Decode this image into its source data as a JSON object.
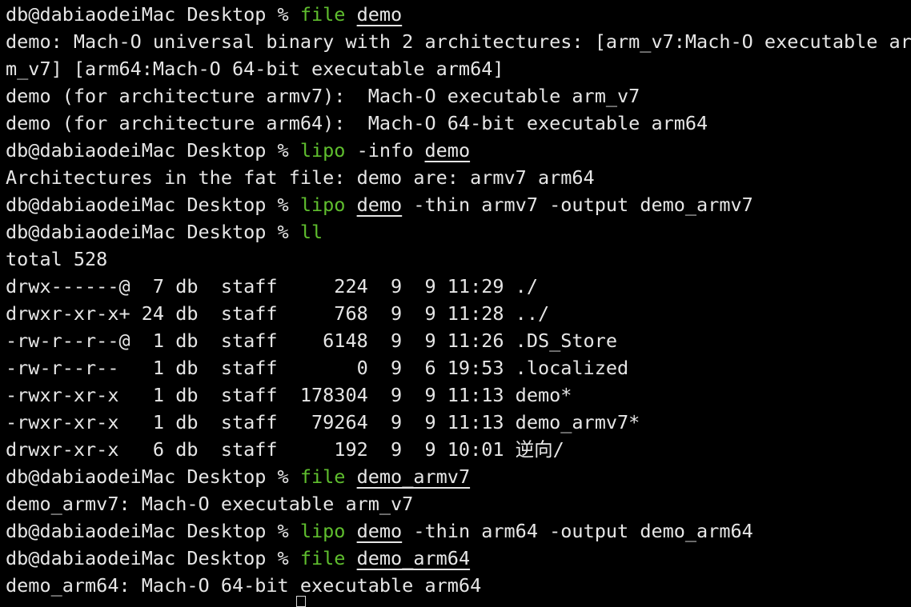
{
  "terminal": {
    "prompt": "db@dabiaodeiMac Desktop % ",
    "lines": [
      {
        "type": "command",
        "parts": [
          {
            "t": "db@dabiaodeiMac Desktop % ",
            "s": "prompt"
          },
          {
            "t": "file",
            "s": "cmd"
          },
          {
            "t": " ",
            "s": "text"
          },
          {
            "t": "demo",
            "s": "arg"
          }
        ]
      },
      {
        "type": "output",
        "text": "demo: Mach-O universal binary with 2 architectures: [arm_v7:Mach-O executable ar"
      },
      {
        "type": "output",
        "text": "m_v7] [arm64:Mach-O 64-bit executable arm64]"
      },
      {
        "type": "output",
        "text": "demo (for architecture armv7):  Mach-O executable arm_v7"
      },
      {
        "type": "output",
        "text": "demo (for architecture arm64):  Mach-O 64-bit executable arm64"
      },
      {
        "type": "command",
        "parts": [
          {
            "t": "db@dabiaodeiMac Desktop % ",
            "s": "prompt"
          },
          {
            "t": "lipo",
            "s": "cmd"
          },
          {
            "t": " -info ",
            "s": "text"
          },
          {
            "t": "demo",
            "s": "arg"
          }
        ]
      },
      {
        "type": "output",
        "text": "Architectures in the fat file: demo are: armv7 arm64"
      },
      {
        "type": "command",
        "parts": [
          {
            "t": "db@dabiaodeiMac Desktop % ",
            "s": "prompt"
          },
          {
            "t": "lipo",
            "s": "cmd"
          },
          {
            "t": " ",
            "s": "text"
          },
          {
            "t": "demo",
            "s": "arg"
          },
          {
            "t": " -thin armv7 -output demo_armv7",
            "s": "text"
          }
        ]
      },
      {
        "type": "command",
        "parts": [
          {
            "t": "db@dabiaodeiMac Desktop % ",
            "s": "prompt"
          },
          {
            "t": "ll",
            "s": "cmd"
          }
        ]
      },
      {
        "type": "output",
        "text": "total 528"
      },
      {
        "type": "output",
        "text": "drwx------@  7 db  staff     224  9  9 11:29 ./"
      },
      {
        "type": "output",
        "text": "drwxr-xr-x+ 24 db  staff     768  9  9 11:28 ../"
      },
      {
        "type": "output",
        "text": "-rw-r--r--@  1 db  staff    6148  9  9 11:26 .DS_Store"
      },
      {
        "type": "output",
        "text": "-rw-r--r--   1 db  staff       0  9  6 19:53 .localized"
      },
      {
        "type": "output",
        "text": "-rwxr-xr-x   1 db  staff  178304  9  9 11:13 demo*"
      },
      {
        "type": "output",
        "text": "-rwxr-xr-x   1 db  staff   79264  9  9 11:13 demo_armv7*"
      },
      {
        "type": "output",
        "text": "drwxr-xr-x   6 db  staff     192  9  9 10:01 逆向/"
      },
      {
        "type": "command",
        "parts": [
          {
            "t": "db@dabiaodeiMac Desktop % ",
            "s": "prompt"
          },
          {
            "t": "file",
            "s": "cmd"
          },
          {
            "t": " ",
            "s": "text"
          },
          {
            "t": "demo_armv7",
            "s": "arg"
          }
        ]
      },
      {
        "type": "output",
        "text": "demo_armv7: Mach-O executable arm_v7"
      },
      {
        "type": "command",
        "parts": [
          {
            "t": "db@dabiaodeiMac Desktop % ",
            "s": "prompt"
          },
          {
            "t": "lipo",
            "s": "cmd"
          },
          {
            "t": " ",
            "s": "text"
          },
          {
            "t": "demo",
            "s": "arg"
          },
          {
            "t": " -thin arm64 -output demo_arm64",
            "s": "text"
          }
        ]
      },
      {
        "type": "command",
        "parts": [
          {
            "t": "db@dabiaodeiMac Desktop % ",
            "s": "prompt"
          },
          {
            "t": "file",
            "s": "cmd"
          },
          {
            "t": " ",
            "s": "text"
          },
          {
            "t": "demo_arm64",
            "s": "arg"
          }
        ]
      },
      {
        "type": "output",
        "text": "demo_arm64: Mach-O 64-bit executable arm64"
      }
    ]
  },
  "colors": {
    "background": "#000000",
    "text": "#e6e6e6",
    "command": "#5fbe2e"
  }
}
